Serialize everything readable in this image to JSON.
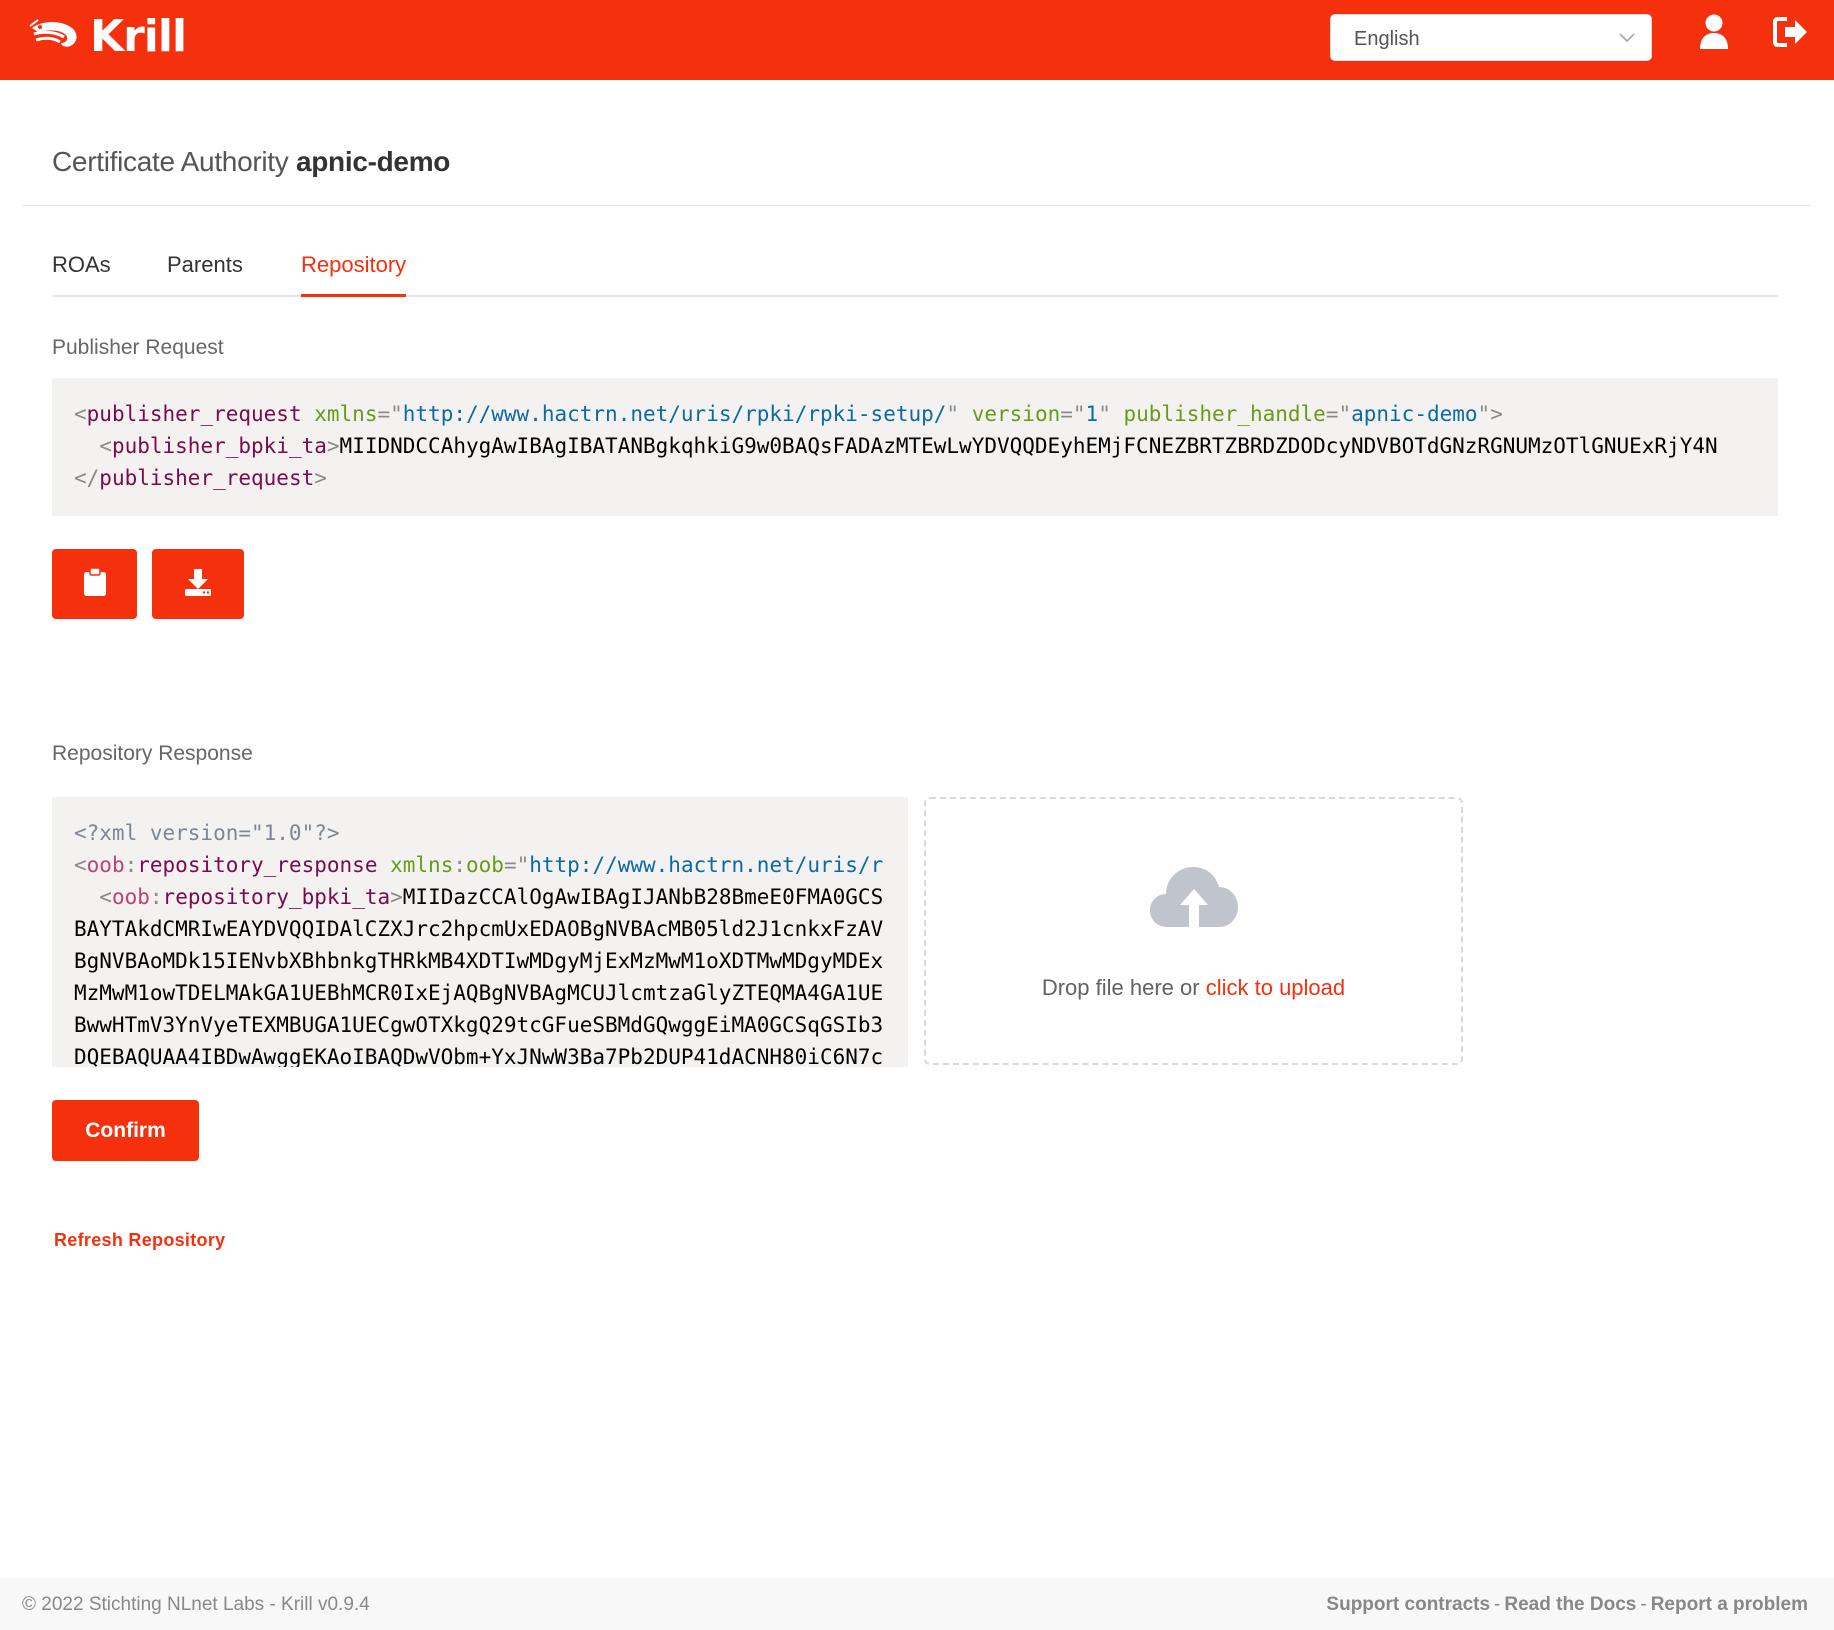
{
  "header": {
    "app_name": "Krill",
    "language": "English",
    "icons": {
      "logo": "shrimp-logo-icon",
      "user": "user-icon",
      "logout": "logout-icon",
      "dropdown": "chevron-down-icon"
    }
  },
  "page": {
    "title_prefix": "Certificate Authority",
    "ca_name": "apnic-demo"
  },
  "tabs": [
    {
      "label": "ROAs",
      "active": false
    },
    {
      "label": "Parents",
      "active": false
    },
    {
      "label": "Repository",
      "active": true
    }
  ],
  "publisher_request": {
    "label": "Publisher Request",
    "xml": {
      "open_tag": "publisher_request",
      "xmlns_attr": "xmlns",
      "xmlns_value": "http://www.hactrn.net/uris/rpki/rpki-setup/",
      "version_attr": "version",
      "version_value": "1",
      "handle_attr": "publisher_handle",
      "handle_value": "apnic-demo",
      "child_tag": "publisher_bpki_ta",
      "child_content": "MIIDNDCCAhygAwIBAgIBATANBgkqhkiG9w0BAQsFADAzMTEwLwYDVQQDEyhEMjFCNEZBRTZBRDZDODcyNDVBOTdGNzRGNUMzOTlGNUExRjY4N",
      "close_tag": "publisher_request"
    },
    "buttons": {
      "copy_icon": "clipboard-icon",
      "download_icon": "download-icon"
    }
  },
  "repository_response": {
    "label": "Repository Response",
    "xml": {
      "declaration": "<?xml version=\"1.0\"?>",
      "ns_prefix": "oob",
      "root_tag": "repository_response",
      "xmlns_attr": "xmlns",
      "xmlns_value": "http://www.hactrn.net/uris/r",
      "child_tag": "repository_bpki_ta",
      "child_content": "MIIDazCCAlOgAwIBAgIJANbB28BmeE0FMA0GCS",
      "body_lines": [
        "BAYTAkdCMRIwEAYDVQQIDAlCZXJrc2hpcmUxEDAOBgNVBAcMB05ld2J1cnkxFzAV",
        "BgNVBAoMDk15IENvbXBhbnkgTHRkMB4XDTIwMDgyMjExMzMwM1oXDTMwMDgyMDEx",
        "MzMwM1owTDELMAkGA1UEBhMCR0IxEjAQBgNVBAgMCUJlcmtzaGlyZTEQMA4GA1UE",
        "BwwHTmV3YnVyeTEXMBUGA1UECgwOTXkgQ29tcGFueSBMdGQwggEiMA0GCSqGSIb3",
        "DQEBAQUAA4IBDwAwggEKAoIBAQDwVObm+YxJNwW3Ba7Pb2DUP41dACNH80iC6N7c"
      ]
    },
    "upload": {
      "icon": "cloud-upload-icon",
      "text": "Drop file here or",
      "link": "click to upload"
    },
    "confirm_label": "Confirm"
  },
  "refresh_label": "Refresh Repository",
  "footer": {
    "copyright": "© 2022 Stichting NLnet Labs - Krill v0.9.4",
    "links": [
      "Support contracts",
      "Read the Docs",
      "Report a problem"
    ],
    "separator": "-"
  },
  "colors": {
    "brand": "#f5300c",
    "code_bg": "#f4f2f0"
  }
}
